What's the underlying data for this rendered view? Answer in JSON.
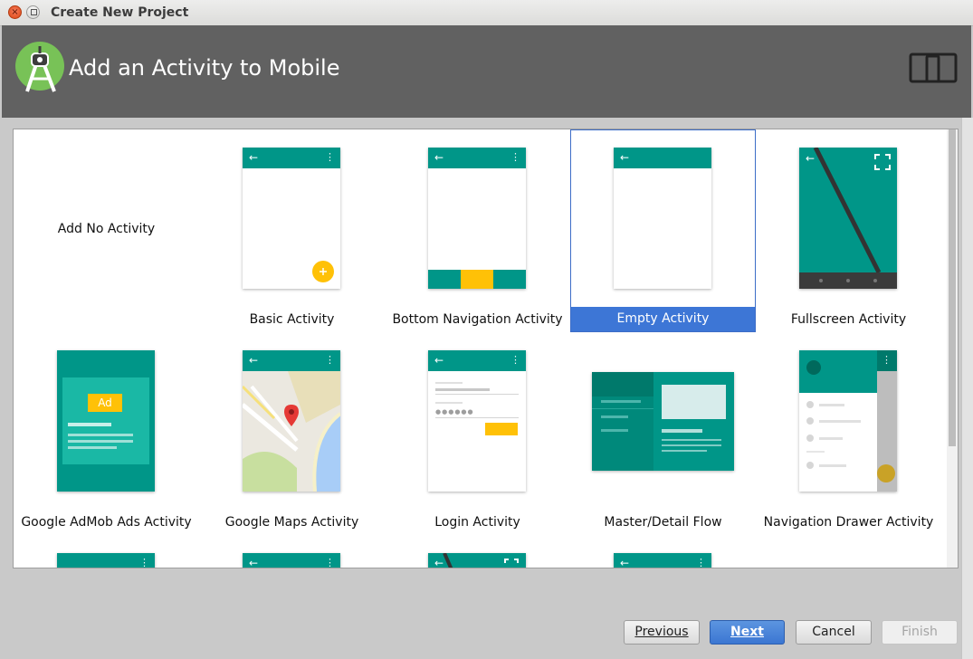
{
  "window": {
    "title": "Create New Project"
  },
  "banner": {
    "heading": "Add an Activity to Mobile"
  },
  "tiles": [
    {
      "label": "Add No Activity"
    },
    {
      "label": "Basic Activity"
    },
    {
      "label": "Bottom Navigation Activity"
    },
    {
      "label": "Empty Activity",
      "selected": true
    },
    {
      "label": "Fullscreen Activity"
    },
    {
      "label": "Google AdMob Ads Activity",
      "badge": "Ad"
    },
    {
      "label": "Google Maps Activity"
    },
    {
      "label": "Login Activity"
    },
    {
      "label": "Master/Detail Flow"
    },
    {
      "label": "Navigation Drawer Activity"
    }
  ],
  "buttons": {
    "previous": "Previous",
    "next": "Next",
    "cancel": "Cancel",
    "finish": "Finish"
  },
  "colors": {
    "teal": "#009688",
    "accent": "#ffc107",
    "selection": "#3d76d6",
    "banner": "#616161"
  },
  "icons": {
    "logo": "android-studio-logo-icon",
    "device": "phone-tablet-icon",
    "back": "arrow-left-icon",
    "menu": "overflow-menu-icon",
    "fullscreen": "fullscreen-icon"
  }
}
